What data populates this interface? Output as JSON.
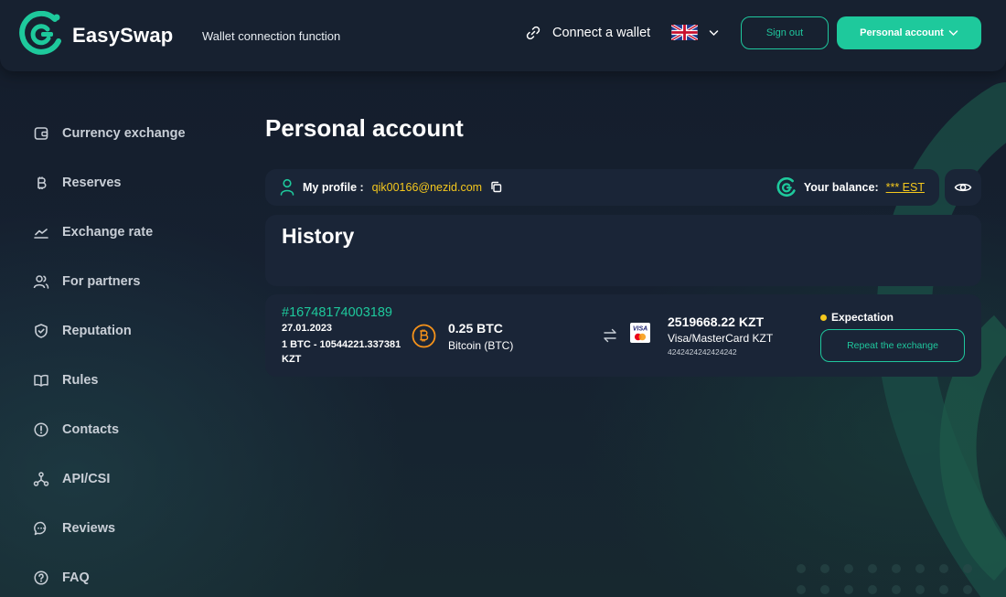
{
  "header": {
    "logo_text": "EasySwap",
    "tagline": "Wallet connection function",
    "connect_label": "Connect a wallet",
    "language_flag": "uk-flag-icon",
    "sign_out_label": "Sign out",
    "account_label": "Personal account"
  },
  "sidebar": {
    "items": [
      {
        "label": "Currency exchange",
        "icon": "wallet-icon"
      },
      {
        "label": "Reserves",
        "icon": "bitcoin-icon"
      },
      {
        "label": "Exchange rate",
        "icon": "chart-line-icon"
      },
      {
        "label": "For partners",
        "icon": "users-icon"
      },
      {
        "label": "Reputation",
        "icon": "shield-check-icon"
      },
      {
        "label": "Rules",
        "icon": "book-icon"
      },
      {
        "label": "Contacts",
        "icon": "info-circle-icon"
      },
      {
        "label": "API/CSI",
        "icon": "nodes-icon"
      },
      {
        "label": "Reviews",
        "icon": "chat-icon"
      },
      {
        "label": "FAQ",
        "icon": "question-icon"
      }
    ]
  },
  "main": {
    "title": "Personal account",
    "profile": {
      "label": "My profile :",
      "email": "qik00166@nezid.com",
      "balance_label": "Your balance:",
      "balance_value": "*** EST"
    },
    "history": {
      "title": "History",
      "orders": [
        {
          "id": "#16748174003189",
          "date": "27.01.2023",
          "rate": "1 BTC - 10544221.337381 KZT",
          "from_amount": "0.25 BTC",
          "from_name": "Bitcoin (BTC)",
          "to_amount": "2519668.22 KZT",
          "to_name": "Visa/MasterCard KZT",
          "to_account": "4242424242424242",
          "status": "Expectation",
          "repeat_label": "Repeat the exchange"
        }
      ]
    }
  },
  "colors": {
    "accent": "#1ec99c",
    "highlight": "#f5c81d",
    "background": "#131d2a",
    "card": "#1a2537",
    "bitcoin": "#f7931a"
  }
}
